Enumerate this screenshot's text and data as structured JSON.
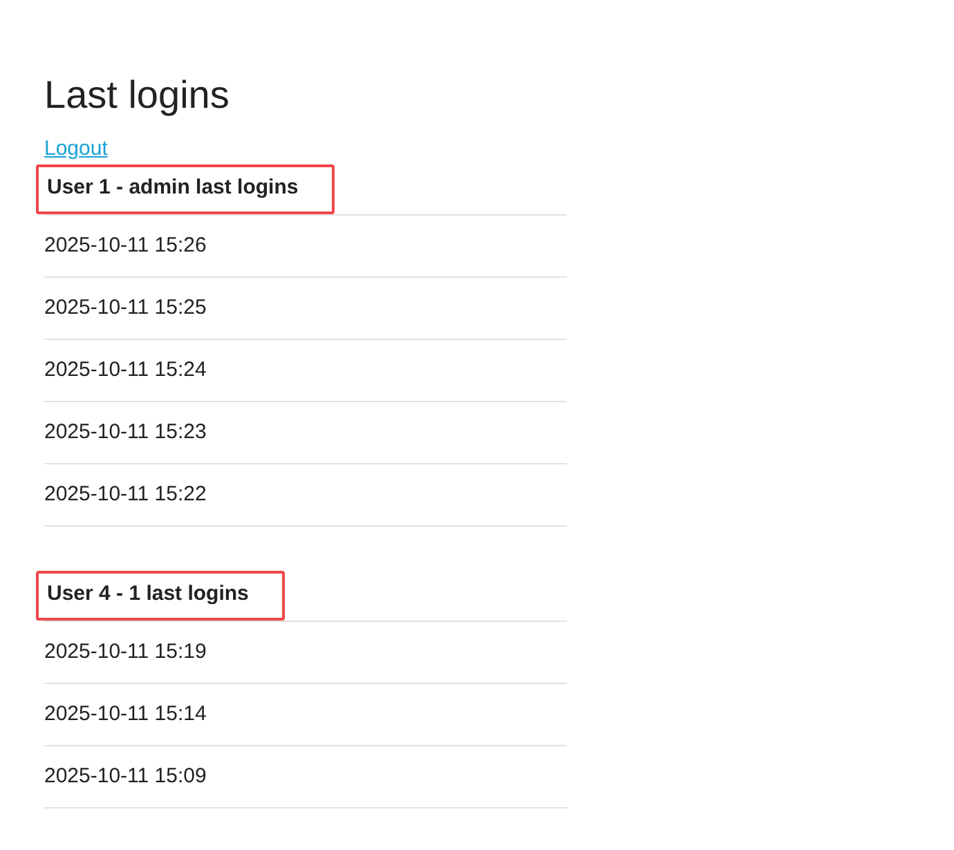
{
  "title": "Last logins",
  "logout_link": "Logout",
  "sections": [
    {
      "heading": "User 1 - admin last logins",
      "highlighted": true,
      "logins": [
        "2025-10-11 15:26",
        "2025-10-11 15:25",
        "2025-10-11 15:24",
        "2025-10-11 15:23",
        "2025-10-11 15:22"
      ]
    },
    {
      "heading": "User 4 - 1 last logins",
      "highlighted": true,
      "logins": [
        "2025-10-11 15:19",
        "2025-10-11 15:14",
        "2025-10-11 15:09"
      ]
    }
  ]
}
